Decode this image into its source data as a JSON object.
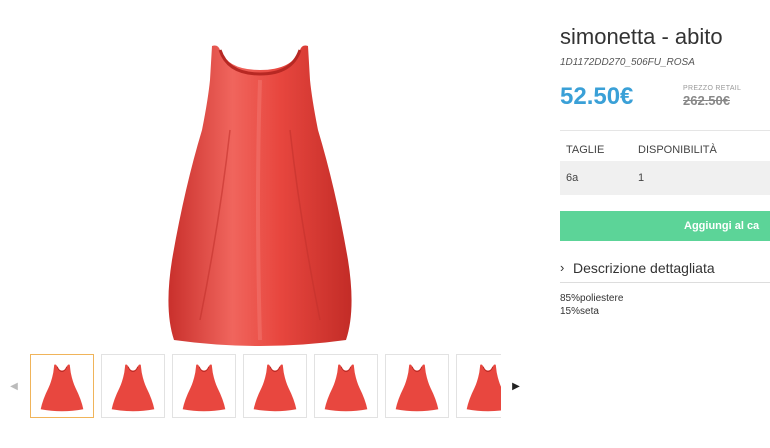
{
  "product": {
    "title": "simonetta - abito",
    "sku": "1D1172DD270_506FU_ROSA",
    "price": "52.50€",
    "retail_label": "PREZZO RETAIL",
    "retail_price": "262.50€",
    "color": "#e8473f"
  },
  "sizes": {
    "header_size": "TAGLIE",
    "header_availability": "DISPONIBILITÀ",
    "rows": [
      {
        "size": "6a",
        "qty": "1"
      }
    ]
  },
  "cart": {
    "add_label": "Aggiungi al ca"
  },
  "description": {
    "toggle_label": "Descrizione dettagliata",
    "composition": [
      "85%poliestere",
      "15%seta"
    ]
  },
  "gallery": {
    "thumb_count": 7,
    "active_index": 0
  },
  "colors": {
    "accent_price": "#3aa0d7",
    "cart_button": "#5cd498",
    "active_thumb_border": "#f0b45a"
  }
}
